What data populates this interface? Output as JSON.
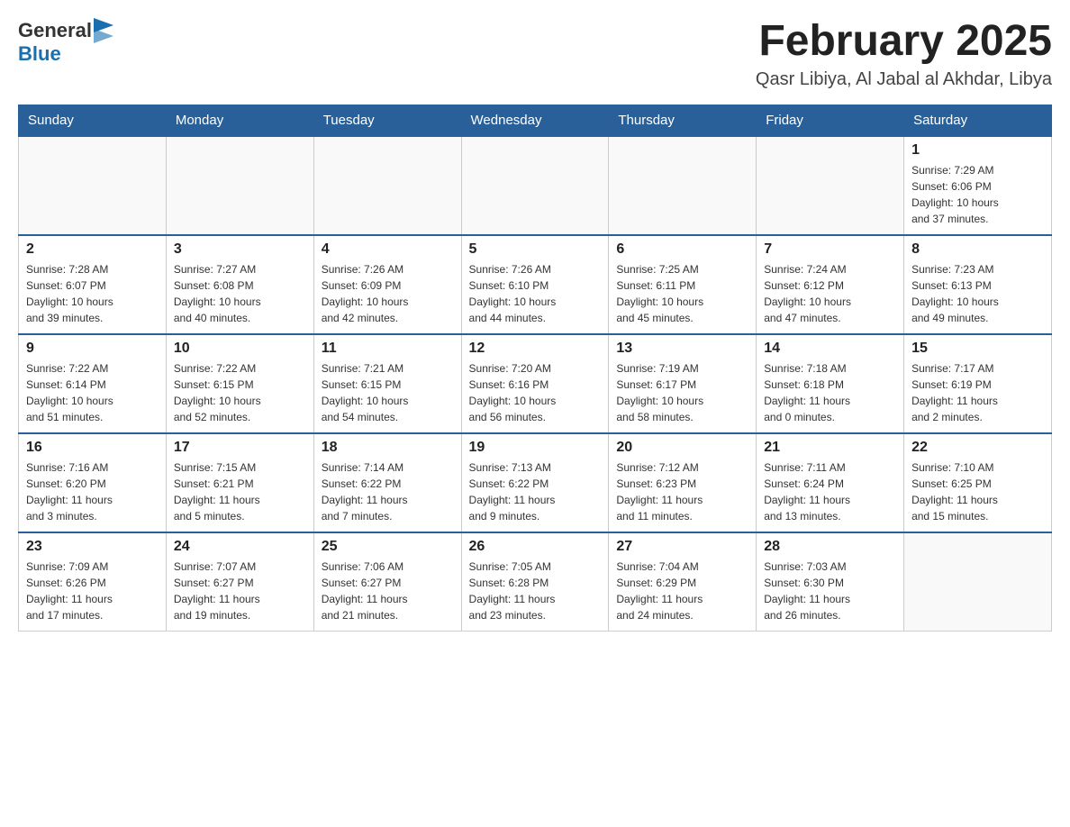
{
  "header": {
    "logo_general": "General",
    "logo_blue": "Blue",
    "month_title": "February 2025",
    "location": "Qasr Libiya, Al Jabal al Akhdar, Libya"
  },
  "days_of_week": [
    "Sunday",
    "Monday",
    "Tuesday",
    "Wednesday",
    "Thursday",
    "Friday",
    "Saturday"
  ],
  "weeks": [
    {
      "days": [
        {
          "num": "",
          "info": ""
        },
        {
          "num": "",
          "info": ""
        },
        {
          "num": "",
          "info": ""
        },
        {
          "num": "",
          "info": ""
        },
        {
          "num": "",
          "info": ""
        },
        {
          "num": "",
          "info": ""
        },
        {
          "num": "1",
          "info": "Sunrise: 7:29 AM\nSunset: 6:06 PM\nDaylight: 10 hours\nand 37 minutes."
        }
      ]
    },
    {
      "days": [
        {
          "num": "2",
          "info": "Sunrise: 7:28 AM\nSunset: 6:07 PM\nDaylight: 10 hours\nand 39 minutes."
        },
        {
          "num": "3",
          "info": "Sunrise: 7:27 AM\nSunset: 6:08 PM\nDaylight: 10 hours\nand 40 minutes."
        },
        {
          "num": "4",
          "info": "Sunrise: 7:26 AM\nSunset: 6:09 PM\nDaylight: 10 hours\nand 42 minutes."
        },
        {
          "num": "5",
          "info": "Sunrise: 7:26 AM\nSunset: 6:10 PM\nDaylight: 10 hours\nand 44 minutes."
        },
        {
          "num": "6",
          "info": "Sunrise: 7:25 AM\nSunset: 6:11 PM\nDaylight: 10 hours\nand 45 minutes."
        },
        {
          "num": "7",
          "info": "Sunrise: 7:24 AM\nSunset: 6:12 PM\nDaylight: 10 hours\nand 47 minutes."
        },
        {
          "num": "8",
          "info": "Sunrise: 7:23 AM\nSunset: 6:13 PM\nDaylight: 10 hours\nand 49 minutes."
        }
      ]
    },
    {
      "days": [
        {
          "num": "9",
          "info": "Sunrise: 7:22 AM\nSunset: 6:14 PM\nDaylight: 10 hours\nand 51 minutes."
        },
        {
          "num": "10",
          "info": "Sunrise: 7:22 AM\nSunset: 6:15 PM\nDaylight: 10 hours\nand 52 minutes."
        },
        {
          "num": "11",
          "info": "Sunrise: 7:21 AM\nSunset: 6:15 PM\nDaylight: 10 hours\nand 54 minutes."
        },
        {
          "num": "12",
          "info": "Sunrise: 7:20 AM\nSunset: 6:16 PM\nDaylight: 10 hours\nand 56 minutes."
        },
        {
          "num": "13",
          "info": "Sunrise: 7:19 AM\nSunset: 6:17 PM\nDaylight: 10 hours\nand 58 minutes."
        },
        {
          "num": "14",
          "info": "Sunrise: 7:18 AM\nSunset: 6:18 PM\nDaylight: 11 hours\nand 0 minutes."
        },
        {
          "num": "15",
          "info": "Sunrise: 7:17 AM\nSunset: 6:19 PM\nDaylight: 11 hours\nand 2 minutes."
        }
      ]
    },
    {
      "days": [
        {
          "num": "16",
          "info": "Sunrise: 7:16 AM\nSunset: 6:20 PM\nDaylight: 11 hours\nand 3 minutes."
        },
        {
          "num": "17",
          "info": "Sunrise: 7:15 AM\nSunset: 6:21 PM\nDaylight: 11 hours\nand 5 minutes."
        },
        {
          "num": "18",
          "info": "Sunrise: 7:14 AM\nSunset: 6:22 PM\nDaylight: 11 hours\nand 7 minutes."
        },
        {
          "num": "19",
          "info": "Sunrise: 7:13 AM\nSunset: 6:22 PM\nDaylight: 11 hours\nand 9 minutes."
        },
        {
          "num": "20",
          "info": "Sunrise: 7:12 AM\nSunset: 6:23 PM\nDaylight: 11 hours\nand 11 minutes."
        },
        {
          "num": "21",
          "info": "Sunrise: 7:11 AM\nSunset: 6:24 PM\nDaylight: 11 hours\nand 13 minutes."
        },
        {
          "num": "22",
          "info": "Sunrise: 7:10 AM\nSunset: 6:25 PM\nDaylight: 11 hours\nand 15 minutes."
        }
      ]
    },
    {
      "days": [
        {
          "num": "23",
          "info": "Sunrise: 7:09 AM\nSunset: 6:26 PM\nDaylight: 11 hours\nand 17 minutes."
        },
        {
          "num": "24",
          "info": "Sunrise: 7:07 AM\nSunset: 6:27 PM\nDaylight: 11 hours\nand 19 minutes."
        },
        {
          "num": "25",
          "info": "Sunrise: 7:06 AM\nSunset: 6:27 PM\nDaylight: 11 hours\nand 21 minutes."
        },
        {
          "num": "26",
          "info": "Sunrise: 7:05 AM\nSunset: 6:28 PM\nDaylight: 11 hours\nand 23 minutes."
        },
        {
          "num": "27",
          "info": "Sunrise: 7:04 AM\nSunset: 6:29 PM\nDaylight: 11 hours\nand 24 minutes."
        },
        {
          "num": "28",
          "info": "Sunrise: 7:03 AM\nSunset: 6:30 PM\nDaylight: 11 hours\nand 26 minutes."
        },
        {
          "num": "",
          "info": ""
        }
      ]
    }
  ]
}
